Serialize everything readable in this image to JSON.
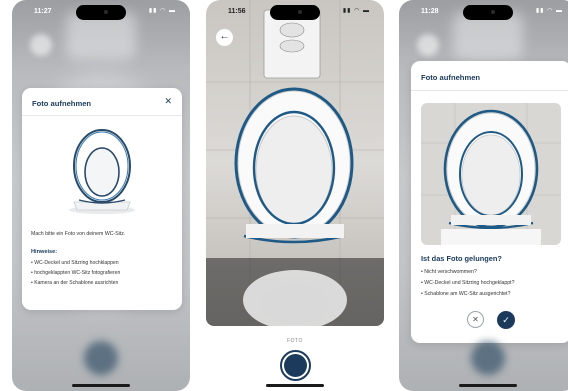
{
  "screen1": {
    "time": "11:27",
    "status_icons": "▮▮ ◠ ▬",
    "card": {
      "title": "Foto aufnehmen",
      "close_glyph": "✕",
      "instruction": "Mach bitte ein Foto von deinem WC-Sitz.",
      "hints_title": "Hinweise:",
      "hints": [
        "• WC-Deckel und Sitzring hochklappen",
        "• hochgeklappten WC-Sitz fotografieren",
        "• Kamera an der Schablone ausrichten"
      ]
    }
  },
  "screen2": {
    "time": "11:56",
    "status_icons": "▮▮ ◠ ▬",
    "back_glyph": "←",
    "camera_label": "FOTO"
  },
  "screen3": {
    "time": "11:28",
    "status_icons": "▮▮ ◠ ▬",
    "card": {
      "title": "Foto aufnehmen",
      "question": "Ist das Foto gelungen?",
      "checks": [
        "• Nicht verschwommen?",
        "• WC-Deckel und Sitzring hochgeklappt?",
        "• Schablone am WC-Sitz ausgerichtet?"
      ],
      "reject_glyph": "✕",
      "accept_glyph": "✓"
    }
  },
  "colors": {
    "brand_navy": "#1c3b5c",
    "overlay_blue": "#1f5a86",
    "blur_gray": "#c1c3c6"
  }
}
